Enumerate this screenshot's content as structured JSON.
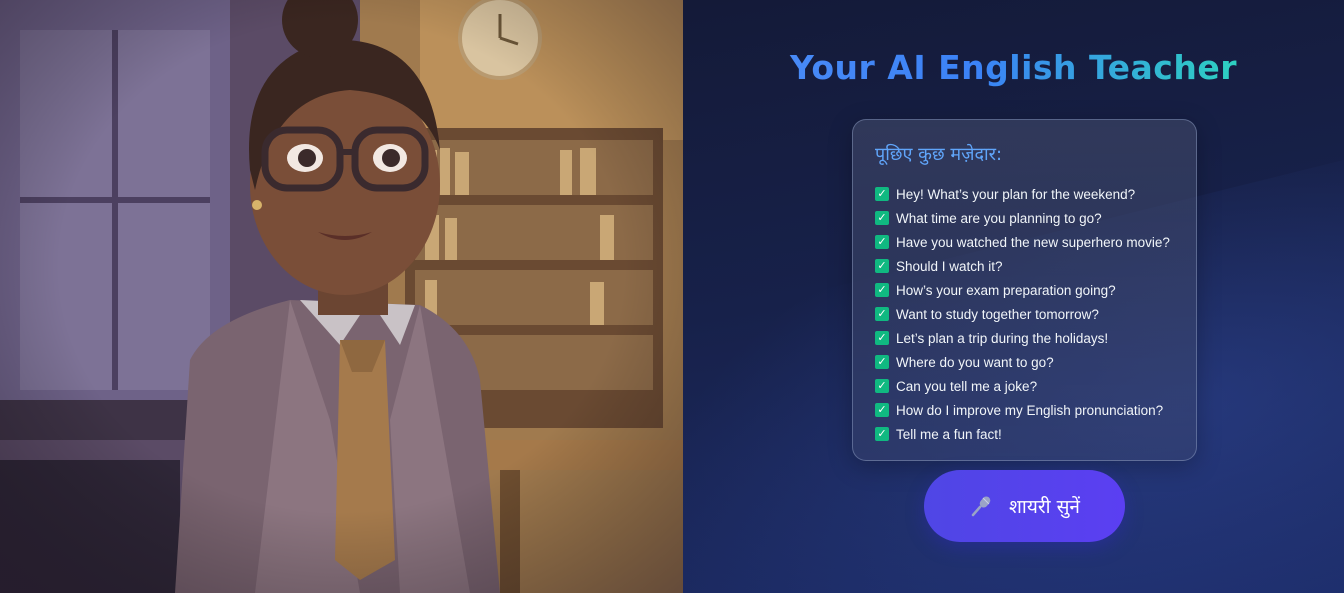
{
  "header": {
    "title": "Your AI English Teacher"
  },
  "hero": {
    "image": "teacher-illustration"
  },
  "suggestions": {
    "heading": "पूछिए कुछ मज़ेदार:",
    "items": [
      "Hey! What’s your plan for the weekend?",
      "What time are you planning to go?",
      "Have you watched the new superhero movie?",
      "Should I watch it?",
      "How’s your exam preparation going?",
      "Want to study together tomorrow?",
      "Let’s plan a trip during the holidays!",
      "Where do you want to go?",
      "Can you tell me a joke?",
      "How do I improve my English pronunciation?",
      "Tell me a fun fact!"
    ]
  },
  "action": {
    "label": "शायरी सुनें",
    "icon": "microphone-icon"
  },
  "colors": {
    "title_gradient_start": "#4f8ef7",
    "title_gradient_end": "#10b981",
    "check": "#10b981",
    "button": "#4f46e5",
    "heading": "#60a5fa"
  }
}
